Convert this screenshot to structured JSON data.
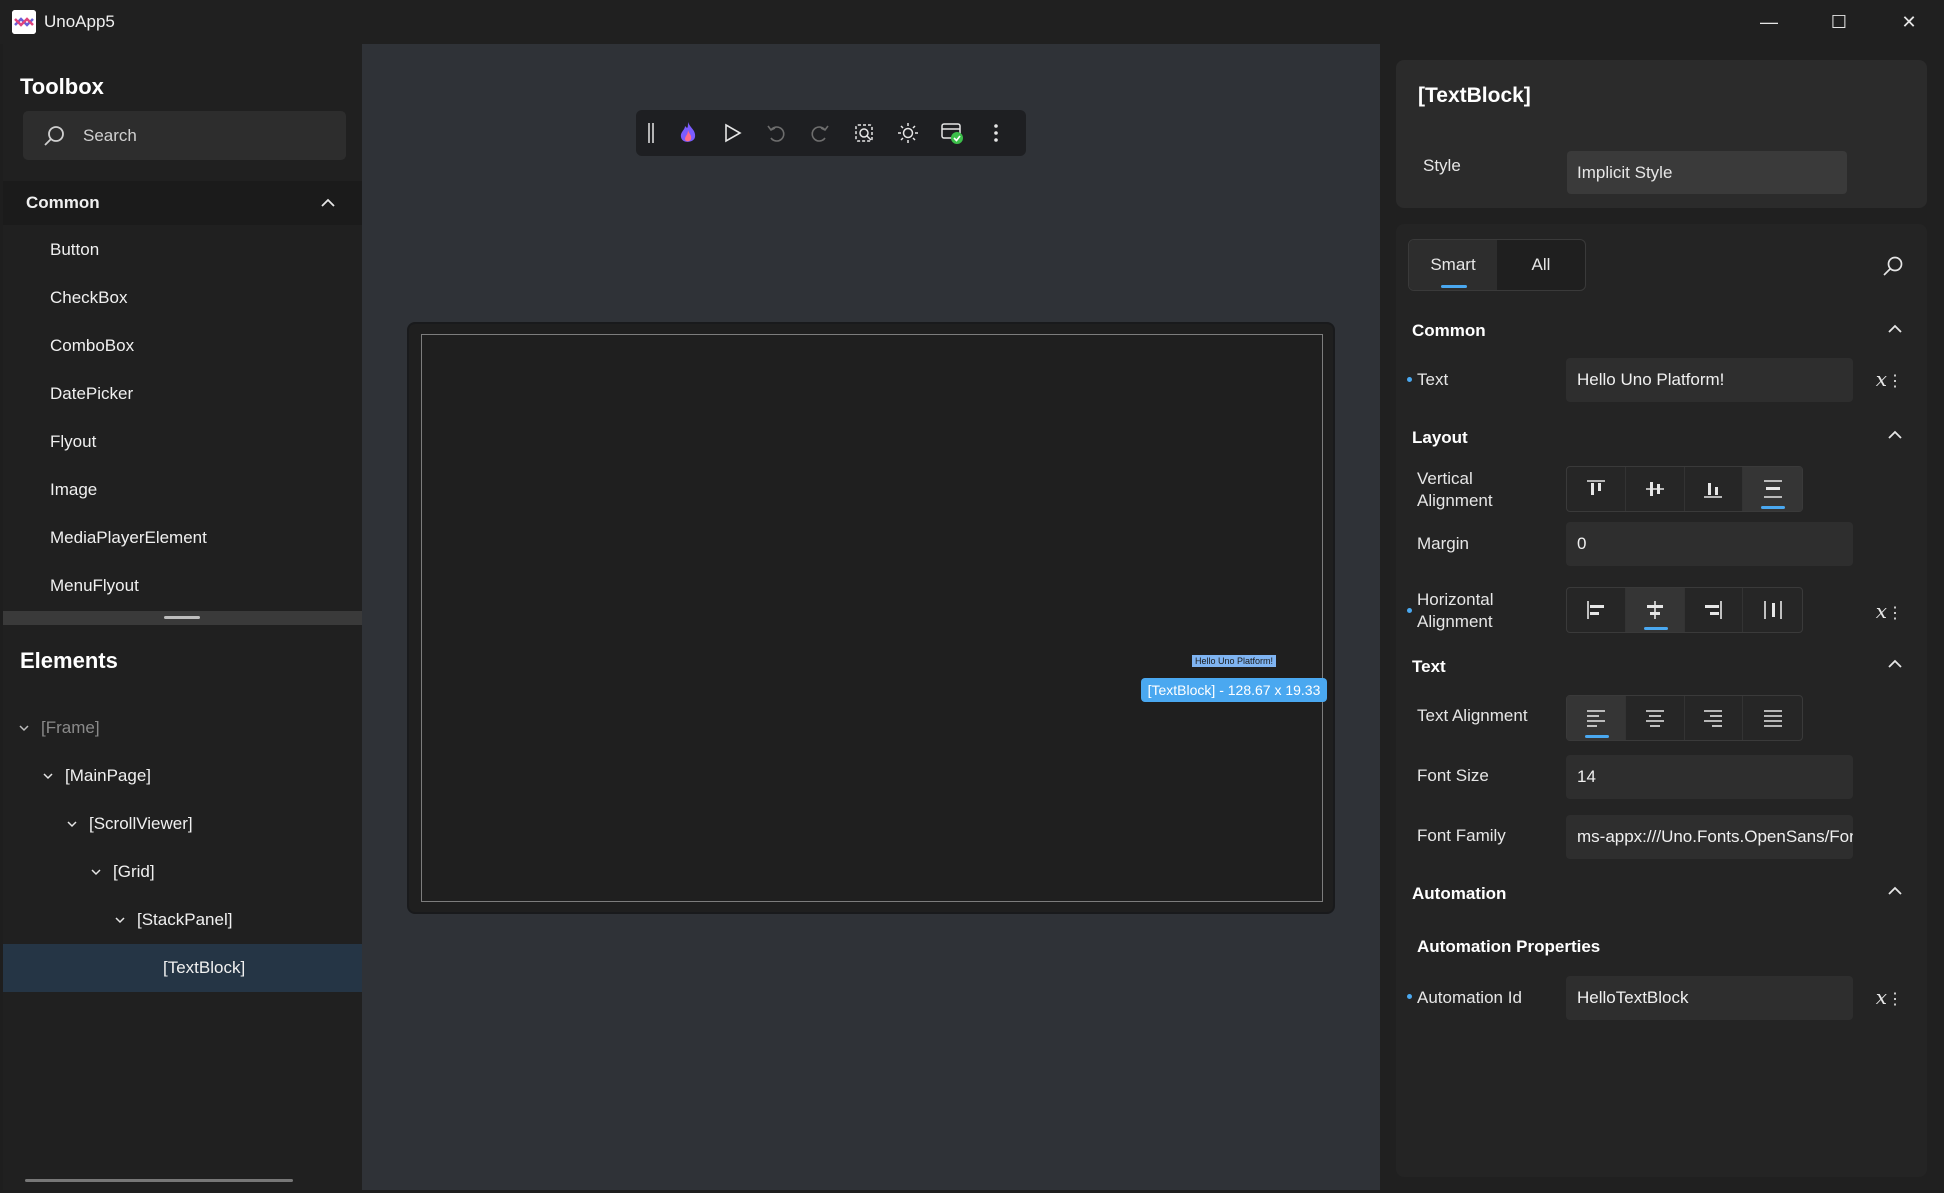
{
  "window": {
    "title": "UnoApp5",
    "minimize": "—",
    "maximize": "☐",
    "close": "✕"
  },
  "toolbox": {
    "title": "Toolbox",
    "search_placeholder": "Search",
    "group": "Common",
    "items": [
      "Button",
      "CheckBox",
      "ComboBox",
      "DatePicker",
      "Flyout",
      "Image",
      "MediaPlayerElement",
      "MenuFlyout"
    ]
  },
  "elements": {
    "title": "Elements",
    "tree": [
      {
        "label": "[Frame]",
        "depth": 0
      },
      {
        "label": "[MainPage]",
        "depth": 1
      },
      {
        "label": "[ScrollViewer]",
        "depth": 2
      },
      {
        "label": "[Grid]",
        "depth": 3
      },
      {
        "label": "[StackPanel]",
        "depth": 4
      },
      {
        "label": "[TextBlock]",
        "depth": 5
      }
    ]
  },
  "canvas": {
    "text_content": "Hello Uno Platform!",
    "selection_badge": "[TextBlock] - 128.67 x 19.33"
  },
  "properties": {
    "element_title": "[TextBlock]",
    "style_label": "Style",
    "style_value": "Implicit Style",
    "tabs": [
      "Smart",
      "All"
    ],
    "sections": {
      "common": "Common",
      "layout": "Layout",
      "text": "Text",
      "automation": "Automation"
    },
    "text_label": "Text",
    "text_value": "Hello Uno Platform!",
    "vertical_alignment_label": "Vertical Alignment",
    "margin_label": "Margin",
    "margin_value": "0",
    "horizontal_alignment_label": "Horizontal Alignment",
    "text_alignment_label": "Text Alignment",
    "font_size_label": "Font Size",
    "font_size_value": "14",
    "font_family_label": "Font Family",
    "font_family_value": "ms-appx:///Uno.Fonts.OpenSans/Fonts/OpenSans.ttf",
    "automation_properties": "Automation Properties",
    "automation_id_label": "Automation Id",
    "automation_id_value": "HelloTextBlock",
    "binding_x": "x",
    "more": "⋮"
  },
  "colors": {
    "accent": "#4aa8f0",
    "selected_row": "#253545",
    "canvas_bg": "#2f3237"
  }
}
